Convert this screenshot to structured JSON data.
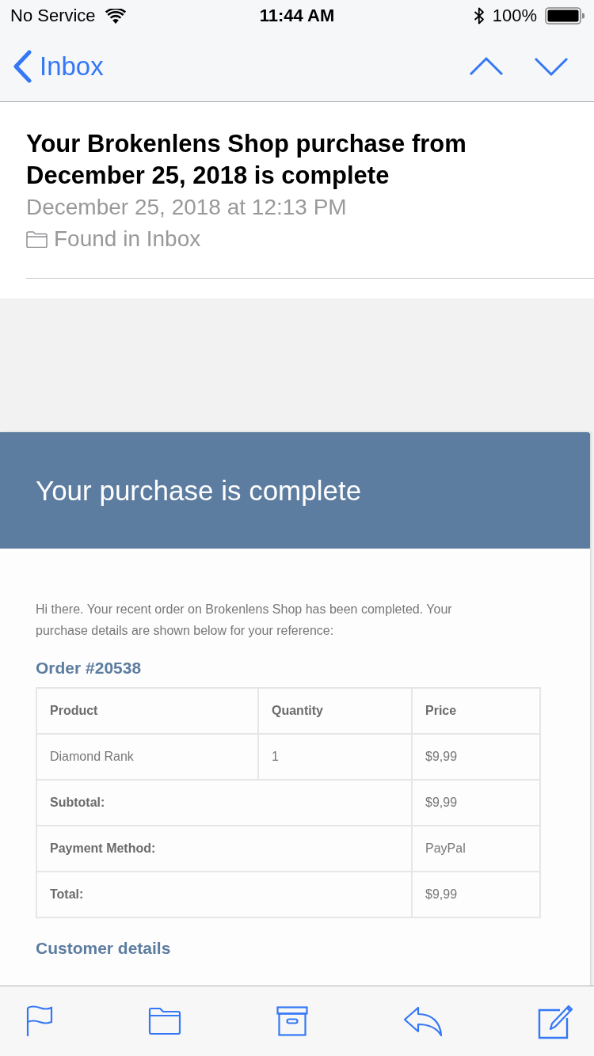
{
  "status_bar": {
    "carrier": "No Service",
    "time": "11:44 AM",
    "battery_percent": "100%"
  },
  "nav_bar": {
    "back_label": "Inbox"
  },
  "message": {
    "subject": "Your Brokenlens Shop purchase from December 25, 2018 is complete",
    "date": "December 25, 2018 at 12:13 PM",
    "location": "Found in Inbox"
  },
  "email": {
    "banner_title": "Your purchase is complete",
    "intro": "Hi there. Your recent order on Brokenlens Shop has been completed. Your purchase details are shown below for your reference:",
    "order_heading": "Order #20538",
    "order_table": {
      "columns": [
        "Product",
        "Quantity",
        "Price"
      ],
      "rows": [
        {
          "kind": "item",
          "cells": [
            "Diamond Rank",
            "1",
            "$9,99"
          ]
        },
        {
          "kind": "total",
          "label": "Subtotal:",
          "value": "$9,99"
        },
        {
          "kind": "total",
          "label": "Payment Method:",
          "value": "PayPal"
        },
        {
          "kind": "total",
          "label": "Total:",
          "value": "$9,99"
        }
      ]
    },
    "customer_heading": "Customer details"
  }
}
